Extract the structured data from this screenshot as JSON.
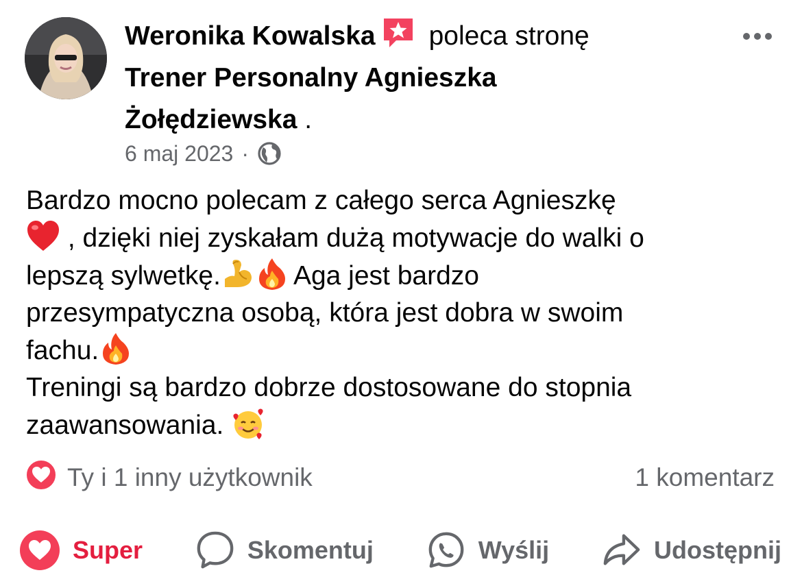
{
  "post": {
    "author": "Weronika Kowalska",
    "action_text": "poleca stronę",
    "page_name_line1": "Trener Personalny Agnieszka",
    "page_name_line2": "Żołędziewska",
    "page_name_suffix": " .",
    "date": "6 maj 2023",
    "separator": "·",
    "visibility_icon": "globe-icon",
    "text": {
      "line1": "Bardzo mocno polecam z całego serca Agnieszkę",
      "line2": " , dzięki niej zyskałam dużą motywacje do walki o",
      "line3a": "lepszą sylwetkę.",
      "line3b": "Aga jest bardzo",
      "line4": "przesympatyczna osobą, która jest dobra w swoim",
      "line5": "fachu.",
      "line6": "Treningi są bardzo dobrze dostosowane  do stopnia",
      "line7": "zaawansowania. "
    }
  },
  "reactions": {
    "summary": "Ty i 1 inny użytkownik",
    "comments": "1 komentarz"
  },
  "actions": {
    "like": "Super",
    "comment": "Skomentuj",
    "send": "Wyślij",
    "share": "Udostępnij"
  },
  "colors": {
    "accent_red": "#e41e3f",
    "meta_gray": "#65676b",
    "text": "#050505"
  }
}
